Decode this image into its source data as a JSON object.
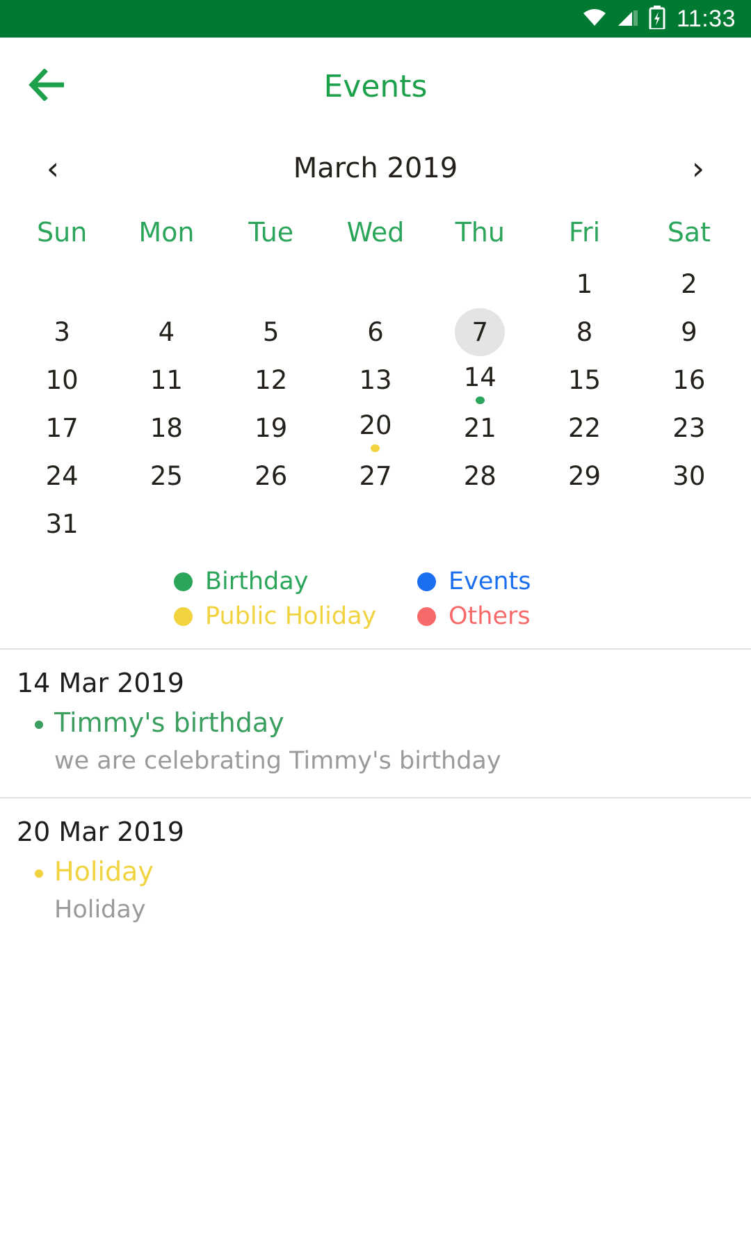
{
  "status_bar": {
    "clock": "11:33",
    "background": "#007a33",
    "icons": [
      "wifi-icon",
      "cellular-signal-icon",
      "battery-charging-icon"
    ]
  },
  "app_bar": {
    "title": "Events",
    "title_color": "#1ca04a",
    "back_icon": "back-arrow-icon"
  },
  "month_nav": {
    "prev_label": "‹",
    "next_label": "›",
    "month_label": "March 2019"
  },
  "calendar": {
    "weekdays": [
      "Sun",
      "Mon",
      "Tue",
      "Wed",
      "Thu",
      "Fri",
      "Sat"
    ],
    "weekday_color": "#2aa55a",
    "today": 7,
    "weeks": [
      [
        {
          "day": ""
        },
        {
          "day": ""
        },
        {
          "day": ""
        },
        {
          "day": ""
        },
        {
          "day": ""
        },
        {
          "day": "1"
        },
        {
          "day": "2"
        }
      ],
      [
        {
          "day": "3"
        },
        {
          "day": "4"
        },
        {
          "day": "5"
        },
        {
          "day": "6"
        },
        {
          "day": "7",
          "today": true
        },
        {
          "day": "8"
        },
        {
          "day": "9"
        }
      ],
      [
        {
          "day": "10"
        },
        {
          "day": "11"
        },
        {
          "day": "12"
        },
        {
          "day": "13"
        },
        {
          "day": "14",
          "dot": "#2aa55a"
        },
        {
          "day": "15"
        },
        {
          "day": "16"
        }
      ],
      [
        {
          "day": "17"
        },
        {
          "day": "18"
        },
        {
          "day": "19"
        },
        {
          "day": "20",
          "dot": "#f0d33f"
        },
        {
          "day": "21"
        },
        {
          "day": "22"
        },
        {
          "day": "23"
        }
      ],
      [
        {
          "day": "24"
        },
        {
          "day": "25"
        },
        {
          "day": "26"
        },
        {
          "day": "27"
        },
        {
          "day": "28"
        },
        {
          "day": "29"
        },
        {
          "day": "30"
        }
      ],
      [
        {
          "day": "31"
        },
        {
          "day": ""
        },
        {
          "day": ""
        },
        {
          "day": ""
        },
        {
          "day": ""
        },
        {
          "day": ""
        },
        {
          "day": ""
        }
      ]
    ]
  },
  "legend": [
    {
      "label": "Birthday",
      "color": "#2aa55a"
    },
    {
      "label": "Events",
      "color": "#1a6ef0"
    },
    {
      "label": "Public Holiday",
      "color": "#f0d33f"
    },
    {
      "label": "Others",
      "color": "#f86a6a"
    }
  ],
  "events": [
    {
      "date": "14 Mar 2019",
      "title": "Timmy's birthday",
      "description": "we are celebrating Timmy's birthday",
      "color": "#3a9e5f"
    },
    {
      "date": "20 Mar 2019",
      "title": "Holiday",
      "description": "Holiday",
      "color": "#f0d33f"
    }
  ]
}
